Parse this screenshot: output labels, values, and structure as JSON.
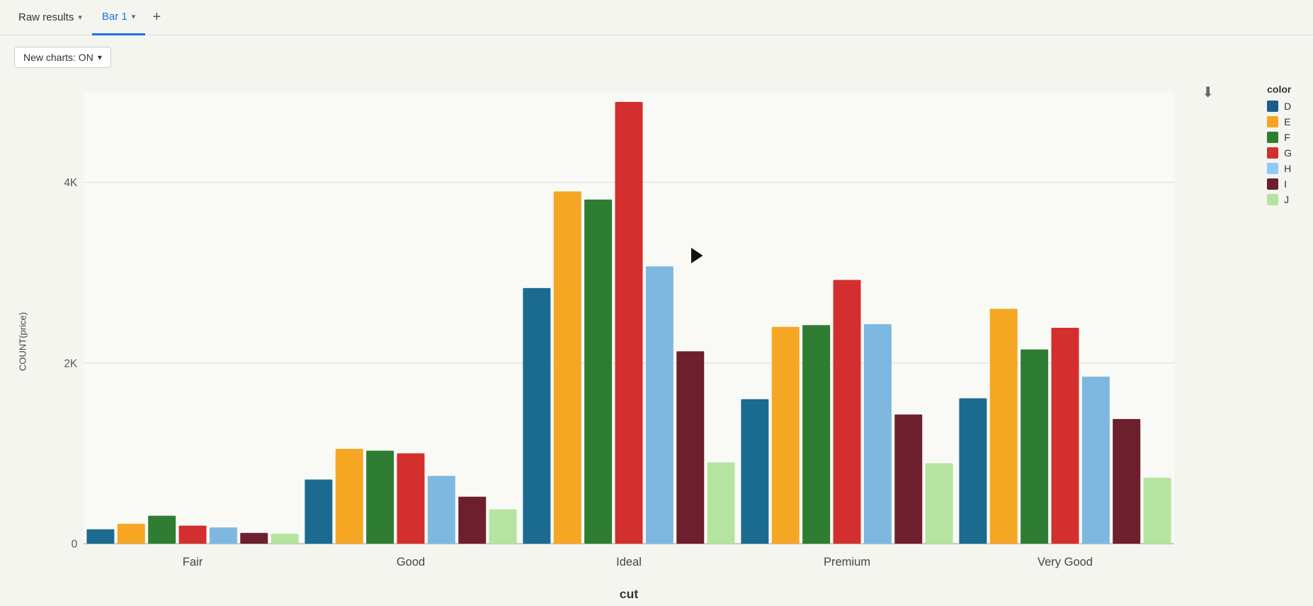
{
  "tabs": [
    {
      "id": "raw-results",
      "label": "Raw results",
      "active": false
    },
    {
      "id": "bar1",
      "label": "Bar 1",
      "active": true
    }
  ],
  "tab_add_label": "+",
  "toolbar": {
    "new_charts_label": "New charts: ON"
  },
  "legend": {
    "title": "color",
    "items": [
      {
        "id": "D",
        "label": "D",
        "color": "#1b5e8a"
      },
      {
        "id": "E",
        "label": "E",
        "color": "#f5a623"
      },
      {
        "id": "F",
        "label": "F",
        "color": "#2e7d32"
      },
      {
        "id": "G",
        "label": "G",
        "color": "#d32f2f"
      },
      {
        "id": "H",
        "label": "H",
        "color": "#90caf9"
      },
      {
        "id": "I",
        "label": "I",
        "color": "#6d1f2e"
      },
      {
        "id": "J",
        "label": "J",
        "color": "#b5e4a0"
      }
    ]
  },
  "chart": {
    "y_axis_label": "COUNT(price)",
    "x_axis_label": "cut",
    "y_ticks": [
      "0",
      "2K",
      "4K"
    ],
    "categories": [
      "Fair",
      "Good",
      "Ideal",
      "Premium",
      "Very Good"
    ],
    "series": {
      "D": {
        "color": "#1b5e8a",
        "values": [
          160,
          710,
          2830,
          1600,
          1610
        ]
      },
      "E": {
        "color": "#f5a623",
        "values": [
          220,
          1050,
          3900,
          2400,
          2600
        ]
      },
      "F": {
        "color": "#2e7d32",
        "values": [
          310,
          1030,
          3810,
          2420,
          2150
        ]
      },
      "G": {
        "color": "#d32f2f",
        "values": [
          200,
          1000,
          4890,
          2920,
          2390
        ]
      },
      "H": {
        "color": "#90caf9",
        "values": [
          180,
          750,
          3070,
          2430,
          1850
        ]
      },
      "I": {
        "color": "#6d1f2e",
        "values": [
          120,
          520,
          2130,
          1430,
          1380
        ]
      },
      "J": {
        "color": "#b5e4a0",
        "values": [
          110,
          380,
          900,
          890,
          730
        ]
      }
    }
  }
}
